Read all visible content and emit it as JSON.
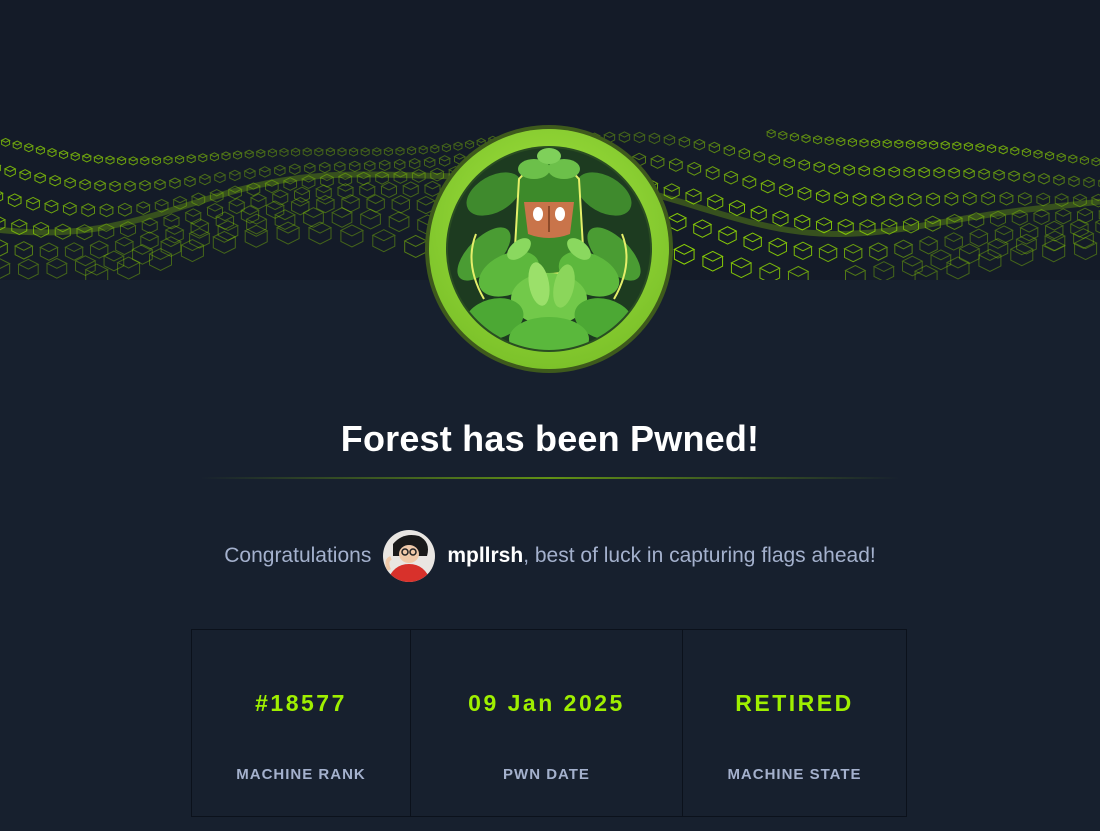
{
  "banner": {
    "icon": "forest-machine-avatar",
    "accent": "#9fef00",
    "background": "#17202e"
  },
  "headline": "Forest has been Pwned!",
  "congrats": {
    "lead": "Congratulations",
    "username": "mpllrsh",
    "tail": ", best of luck in capturing flags ahead!",
    "avatar_icon": "user-avatar"
  },
  "stats": [
    {
      "value": "#18577",
      "label": "MACHINE RANK"
    },
    {
      "value": "09 Jan 2025",
      "label": "PWN DATE"
    },
    {
      "value": "RETIRED",
      "label": "MACHINE STATE"
    }
  ]
}
